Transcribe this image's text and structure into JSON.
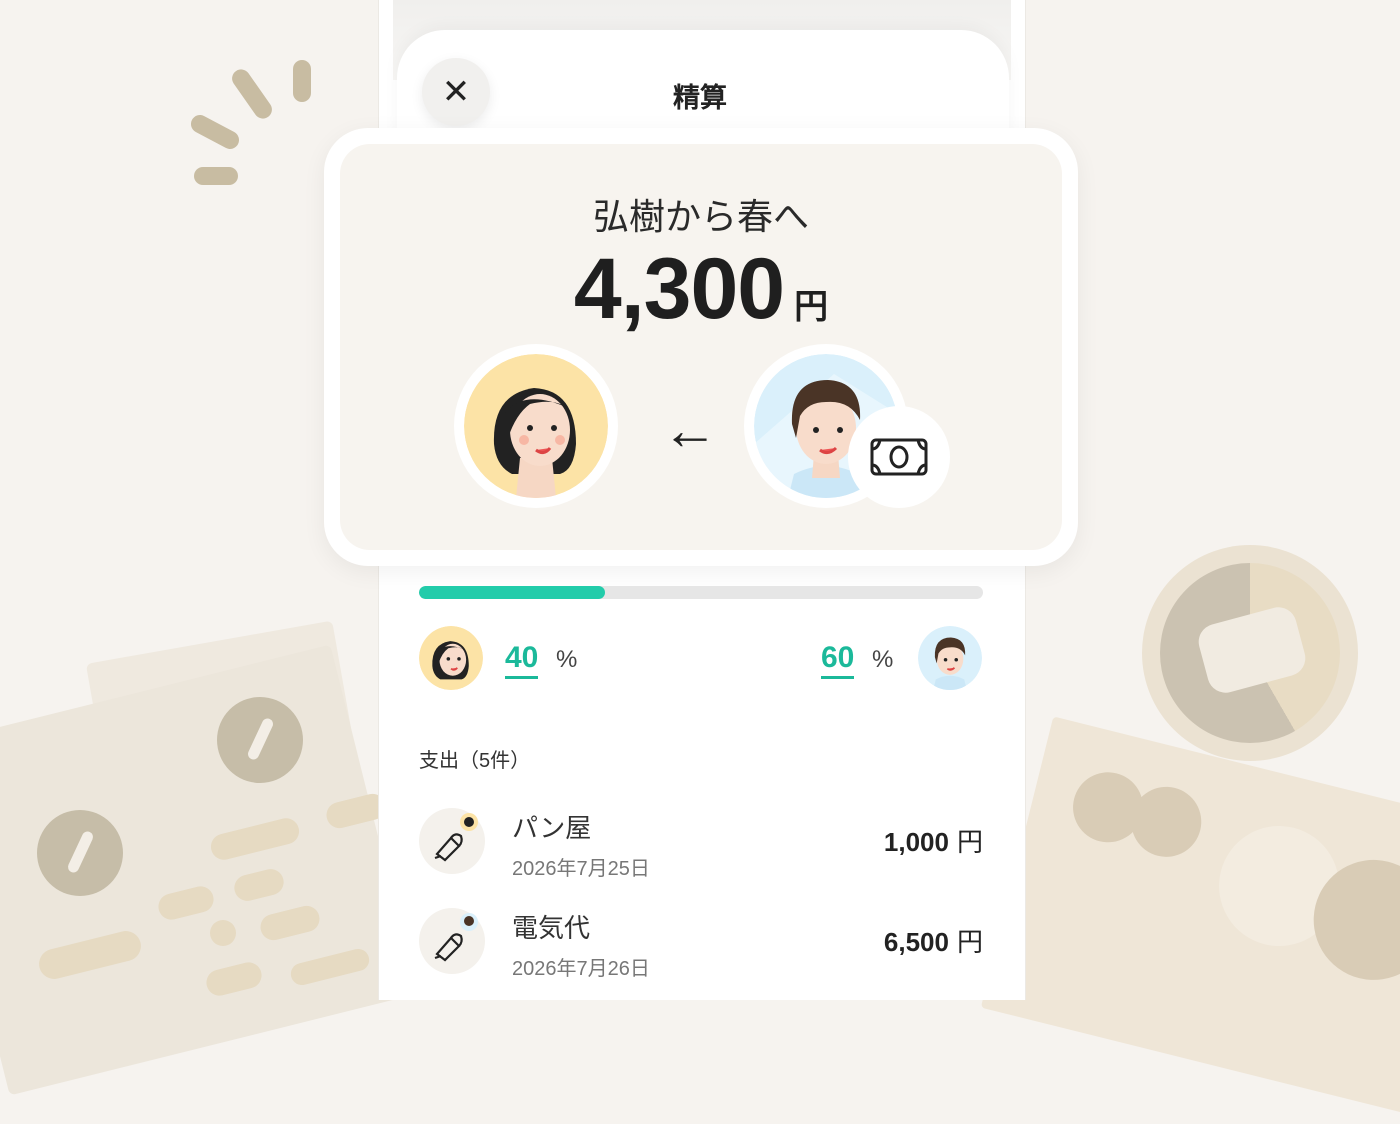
{
  "header": {
    "title": "精算",
    "close_icon": "close-icon"
  },
  "settlement": {
    "direction_label": "弘樹から春へ",
    "amount": "4,300",
    "currency": "円",
    "arrow": "←",
    "payer_icon": "banknote-icon"
  },
  "ratio": {
    "left_percent": "40",
    "right_percent": "60",
    "percent_sign": "%",
    "left_share": 0.33,
    "bar_color": "#22ccaa"
  },
  "expenses": {
    "header": "支出（5件）",
    "items": [
      {
        "name": "パン屋",
        "date": "2026年7月25日",
        "amount": "1,000",
        "currency": "円"
      },
      {
        "name": "電気代",
        "date": "2026年7月26日",
        "amount": "6,500",
        "currency": "円"
      }
    ]
  }
}
